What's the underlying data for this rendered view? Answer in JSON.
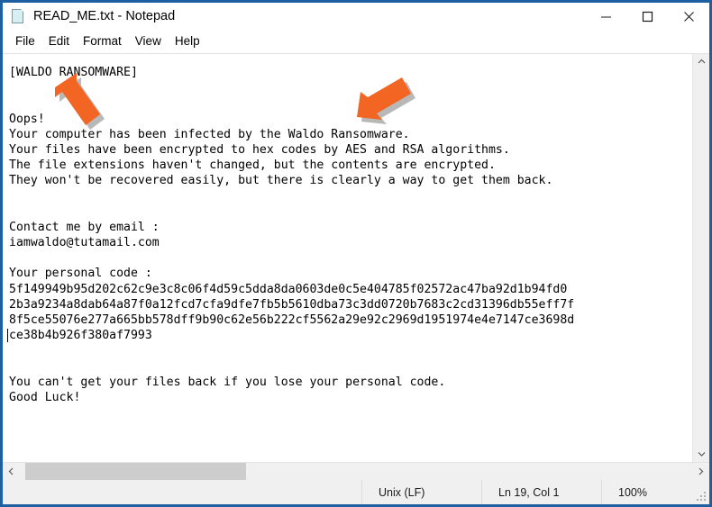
{
  "window": {
    "title": "READ_ME.txt - Notepad",
    "icon": "notepad-document-icon",
    "controls": {
      "minimize": "minimize-button",
      "maximize": "maximize-button",
      "close": "close-button"
    },
    "accent_border_color": "#1d5fa0"
  },
  "menubar": {
    "items": [
      {
        "label": "File"
      },
      {
        "label": "Edit"
      },
      {
        "label": "Format"
      },
      {
        "label": "View"
      },
      {
        "label": "Help"
      }
    ]
  },
  "document": {
    "lines": [
      "[WALDO RANSOMWARE]",
      "",
      "",
      "Oops!",
      "Your computer has been infected by the Waldo Ransomware.",
      "Your files have been encrypted to hex codes by AES and RSA algorithms.",
      "The file extensions haven't changed, but the contents are encrypted.",
      "They won't be recovered easily, but there is clearly a way to get them back.",
      "",
      "",
      "Contact me by email :",
      "iamwaldo@tutamail.com",
      "",
      "Your personal code :",
      "5f149949b95d202c62c9e3c8c06f4d59c5dda8da0603de0c5e404785f02572ac47ba92d1b94fd0",
      "2b3a9234a8dab64a87f0a12fcd7cfa9dfe7fb5b5610dba73c3dd0720b7683c2cd31396db55eff7f",
      "8f5ce55076e277a665bb578dff9b90c62e56b222cf5562a29e92c2969d1951974e4e7147ce3698d",
      "ce38b4b926f380af7993",
      "",
      "",
      "You can't get your files back if you lose your personal code.",
      "Good Luck!"
    ],
    "email": "iamwaldo@tutamail.com",
    "caret_line_index": 17
  },
  "scrollbars": {
    "vertical": {
      "up_arrow": "scroll-up-arrow",
      "down_arrow": "scroll-down-arrow"
    },
    "horizontal": {
      "left_arrow": "scroll-left-arrow",
      "right_arrow": "scroll-right-arrow"
    }
  },
  "statusbar": {
    "line_ending": "Unix (LF)",
    "cursor_position": "Ln 19, Col 1",
    "zoom": "100%"
  },
  "annotations": {
    "color": "#f26522",
    "arrows": [
      {
        "name": "arrow-pointing-to-title",
        "target": "[WALDO RANSOMWARE]"
      },
      {
        "name": "arrow-pointing-to-waldo",
        "target": "Waldo Ransomware"
      }
    ]
  }
}
